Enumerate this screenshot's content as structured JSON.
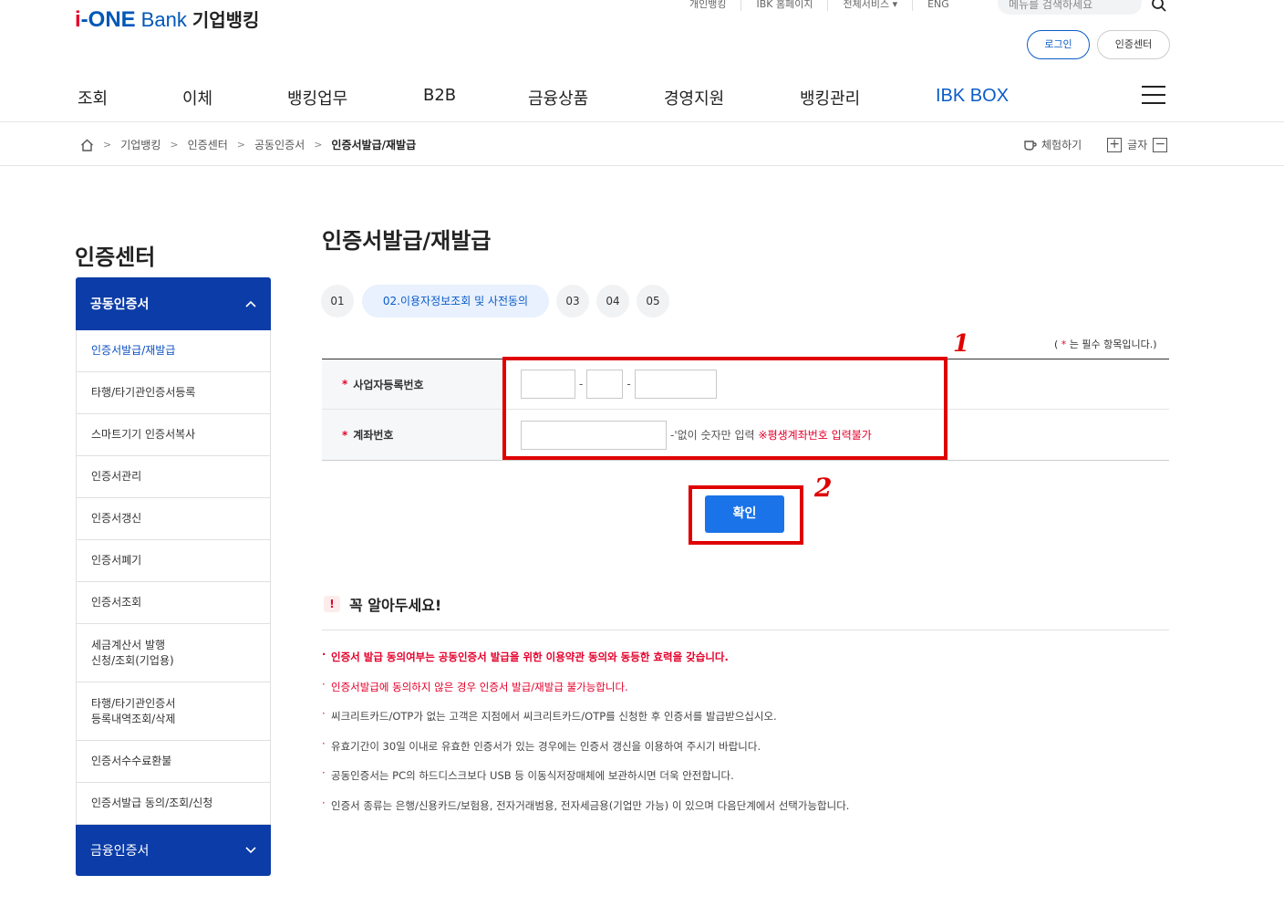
{
  "header": {
    "logo_i": "i",
    "logo_one": "-ONE",
    "logo_bank": "Bank",
    "logo_corp": "기업뱅킹",
    "util_links": [
      "개인뱅킹",
      "IBK 홈페이지",
      "전체서비스 ▾",
      "ENG"
    ],
    "search_placeholder": "메뉴를 검색하세요",
    "login": "로그인",
    "cert_center": "인증센터"
  },
  "gnb": [
    "조회",
    "이체",
    "뱅킹업무",
    "B2B",
    "금융상품",
    "경영지원",
    "뱅킹관리",
    "IBK BOX"
  ],
  "breadcrumb": [
    "기업뱅킹",
    "인증센터",
    "공동인증서",
    "인증서발급/재발급"
  ],
  "tools": {
    "trial": "체험하기",
    "font": "글자"
  },
  "lnb": {
    "title": "인증센터",
    "section": "공동인증서",
    "items": [
      "인증서발급/재발급",
      "타행/타기관인증서등록",
      "스마트기기 인증서복사",
      "인증서관리",
      "인증서갱신",
      "인증서폐기",
      "인증서조회",
      "세금계산서 발행\n신청/조회(기업용)",
      "타행/타기관인증서\n등록내역조회/삭제",
      "인증서수수료환불",
      "인증서발급 동의/조회/신청"
    ],
    "footer_section": "금융인증서"
  },
  "content": {
    "title": "인증서발급/재발급",
    "steps": [
      "01",
      "02.이용자정보조회 및 사전동의",
      "03",
      "04",
      "05"
    ],
    "required_note_pre": "(",
    "required_note_star": "*",
    "required_note_post": "는 필수 항목입니다.)",
    "form": {
      "biz_no_label": "사업자등록번호",
      "account_label": "계좌번호",
      "account_hint": "-'없이 숫자만 입력",
      "account_warn": "※평생계좌번호 입력불가"
    },
    "confirm": "확인",
    "annotations": [
      "1",
      "2"
    ],
    "notice_title": "꼭 알아두세요!",
    "notices": [
      "인증서 발급 동의여부는 공동인증서 발급을 위한 이용약관 동의와 동등한 효력을 갖습니다.",
      "인증서발급에 동의하지 않은 경우 인증서 발급/재발급 불가능합니다.",
      "씨크리트카드/OTP가 없는 고객은 지점에서 씨크리트카드/OTP를 신청한 후 인증서를 발급받으십시오.",
      "유효기간이 30일 이내로 유효한 인증서가 있는 경우에는 인증서 갱신을 이용하여 주시기 바랍니다.",
      "공동인증서는 PC의 하드디스크보다 USB 등 이동식저장매체에 보관하시면 더욱 안전합니다.",
      "인증서 종류는 은행/신용카드/보험용, 전자거래범용, 전자세금용(기업만 가능) 이 있으며 다음단계에서 선택가능합니다."
    ]
  },
  "colors": {
    "brand_blue": "#0b3ca8",
    "accent_red": "#e4002b",
    "annotation_red": "#e00000",
    "button_blue": "#1a73e8"
  }
}
